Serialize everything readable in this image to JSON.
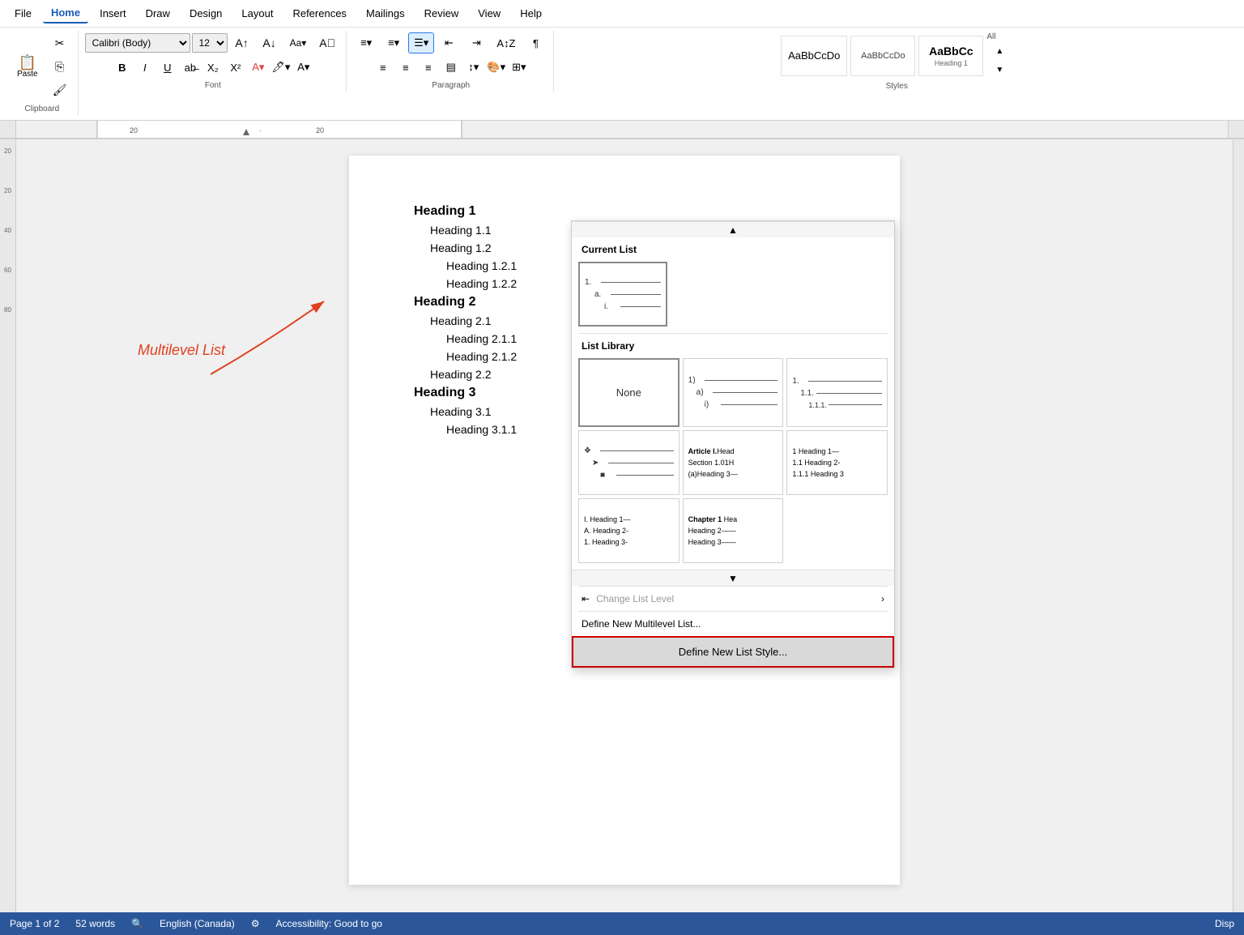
{
  "menu": {
    "items": [
      "File",
      "Home",
      "Insert",
      "Draw",
      "Design",
      "Layout",
      "References",
      "Mailings",
      "Review",
      "View",
      "Help"
    ],
    "active": "Home"
  },
  "ribbon": {
    "clipboard": {
      "label": "Clipboard",
      "paste_label": "Paste"
    },
    "font": {
      "label": "Font",
      "family": "Calibri (Body)",
      "size": "12",
      "bold": "B",
      "italic": "I",
      "underline": "U"
    },
    "paragraph": {
      "label": "Paragraph"
    },
    "styles": {
      "label": "Styles",
      "all_label": "All",
      "items": [
        "AaBbCcDo",
        "AaBbCcDo",
        "AaBbCc"
      ],
      "heading1_label": "Heading 1"
    }
  },
  "document": {
    "headings": [
      {
        "text": "Heading 1",
        "level": 0
      },
      {
        "text": "Heading 1.1",
        "level": 1
      },
      {
        "text": "Heading 1.2",
        "level": 1
      },
      {
        "text": "Heading 1.2.1",
        "level": 2
      },
      {
        "text": "Heading 1.2.2",
        "level": 2
      },
      {
        "text": "Heading 2",
        "level": 0
      },
      {
        "text": "Heading 2.1",
        "level": 1
      },
      {
        "text": "Heading 2.1.1",
        "level": 2
      },
      {
        "text": "Heading 2.1.2",
        "level": 2
      },
      {
        "text": "Heading 2.2",
        "level": 1
      },
      {
        "text": "Heading 3",
        "level": 0
      },
      {
        "text": "Heading 3.1",
        "level": 1
      },
      {
        "text": "Heading 3.1.1",
        "level": 2
      }
    ]
  },
  "dropdown": {
    "current_list_title": "Current List",
    "list_library_title": "List Library",
    "current_list": {
      "lines": [
        "1.",
        "a.",
        "i."
      ]
    },
    "library_options": [
      {
        "type": "none",
        "label": "None"
      },
      {
        "type": "alpha",
        "lines": [
          "1)",
          "a)",
          "i)"
        ]
      },
      {
        "type": "numeric",
        "lines": [
          "1.",
          "1.1.",
          "1.1.1."
        ]
      },
      {
        "type": "bullet",
        "lines": [
          "❖",
          "➤",
          "■"
        ]
      },
      {
        "type": "article",
        "lines": [
          "Article I. Head",
          "Section 1.01H",
          "(a) Heading 3-"
        ]
      },
      {
        "type": "heading_num",
        "lines": [
          "1 Heading 1—",
          "1.1 Heading 2-",
          "1.1.1 Heading 3"
        ]
      },
      {
        "type": "roman_heading",
        "lines": [
          "I. Heading 1—",
          "A. Heading 2-",
          "1. Heading 3-"
        ]
      },
      {
        "type": "chapter",
        "lines": [
          "Chapter 1 Hea",
          "Heading 2——",
          "Heading 3——"
        ]
      }
    ],
    "change_list_level": "Change List Level",
    "define_new_multilevel": "Define New Multilevel List...",
    "define_new_style": "Define New List Style..."
  },
  "annotation": {
    "text": "Multilevel List",
    "color": "#e04020"
  },
  "status_bar": {
    "page_info": "Page 1 of 2",
    "words": "52 words",
    "language": "English (Canada)",
    "accessibility": "Accessibility: Good to go",
    "display": "Disp"
  }
}
